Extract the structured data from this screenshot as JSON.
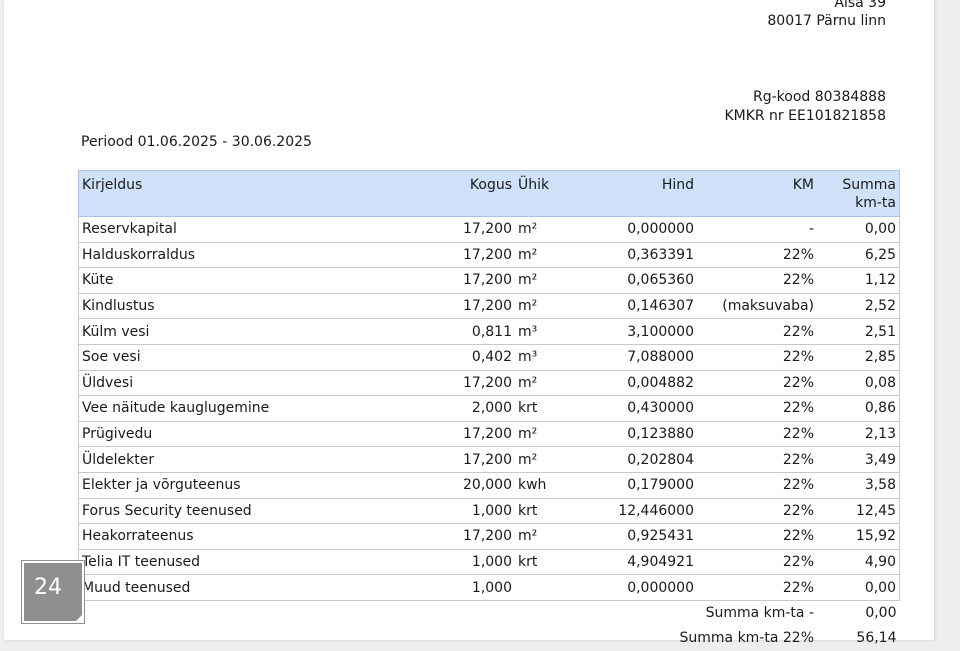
{
  "address": {
    "street": "Aisa 39",
    "city": "80017 Pärnu linn",
    "reg_code": "Rg-kood 80384888",
    "kmkr": "KMKR nr EE101821858"
  },
  "period": "Periood 01.06.2025 - 30.06.2025",
  "table": {
    "headers": {
      "description": "Kirjeldus",
      "quantity": "Kogus",
      "unit": "Ühik",
      "price": "Hind",
      "vat": "KM",
      "sum": "Summa km-ta"
    },
    "rows": [
      {
        "description": "Reservkapital",
        "quantity": "17,200",
        "unit": "m²",
        "price": "0,000000",
        "vat": "-",
        "sum": "0,00"
      },
      {
        "description": "Halduskorraldus",
        "quantity": "17,200",
        "unit": "m²",
        "price": "0,363391",
        "vat": "22%",
        "sum": "6,25"
      },
      {
        "description": "Küte",
        "quantity": "17,200",
        "unit": "m²",
        "price": "0,065360",
        "vat": "22%",
        "sum": "1,12"
      },
      {
        "description": "Kindlustus",
        "quantity": "17,200",
        "unit": "m²",
        "price": "0,146307",
        "vat": "(maksuvaba)",
        "sum": "2,52"
      },
      {
        "description": "Külm vesi",
        "quantity": "0,811",
        "unit": "m³",
        "price": "3,100000",
        "vat": "22%",
        "sum": "2,51"
      },
      {
        "description": "Soe vesi",
        "quantity": "0,402",
        "unit": "m³",
        "price": "7,088000",
        "vat": "22%",
        "sum": "2,85"
      },
      {
        "description": "Üldvesi",
        "quantity": "17,200",
        "unit": "m²",
        "price": "0,004882",
        "vat": "22%",
        "sum": "0,08"
      },
      {
        "description": "Vee näitude kauglugemine",
        "quantity": "2,000",
        "unit": "krt",
        "price": "0,430000",
        "vat": "22%",
        "sum": "0,86"
      },
      {
        "description": "Prügivedu",
        "quantity": "17,200",
        "unit": "m²",
        "price": "0,123880",
        "vat": "22%",
        "sum": "2,13"
      },
      {
        "description": "Üldelekter",
        "quantity": "17,200",
        "unit": "m²",
        "price": "0,202804",
        "vat": "22%",
        "sum": "3,49"
      },
      {
        "description": "Elekter ja võrguteenus",
        "quantity": "20,000",
        "unit": "kwh",
        "price": "0,179000",
        "vat": "22%",
        "sum": "3,58"
      },
      {
        "description": "Forus Security teenused",
        "quantity": "1,000",
        "unit": "krt",
        "price": "12,446000",
        "vat": "22%",
        "sum": "12,45"
      },
      {
        "description": "Heakorrateenus",
        "quantity": "17,200",
        "unit": "m²",
        "price": "0,925431",
        "vat": "22%",
        "sum": "15,92"
      },
      {
        "description": "Telia IT teenused",
        "quantity": "1,000",
        "unit": "krt",
        "price": "4,904921",
        "vat": "22%",
        "sum": "4,90"
      },
      {
        "description": "Muud teenused",
        "quantity": "1,000",
        "unit": "",
        "price": "0,000000",
        "vat": "22%",
        "sum": "0,00"
      }
    ],
    "totals": [
      {
        "label": "Summa km-ta -",
        "value": "0,00"
      },
      {
        "label": "Summa km-ta 22%",
        "value": "56,14"
      }
    ]
  },
  "badge": {
    "number": "24"
  }
}
